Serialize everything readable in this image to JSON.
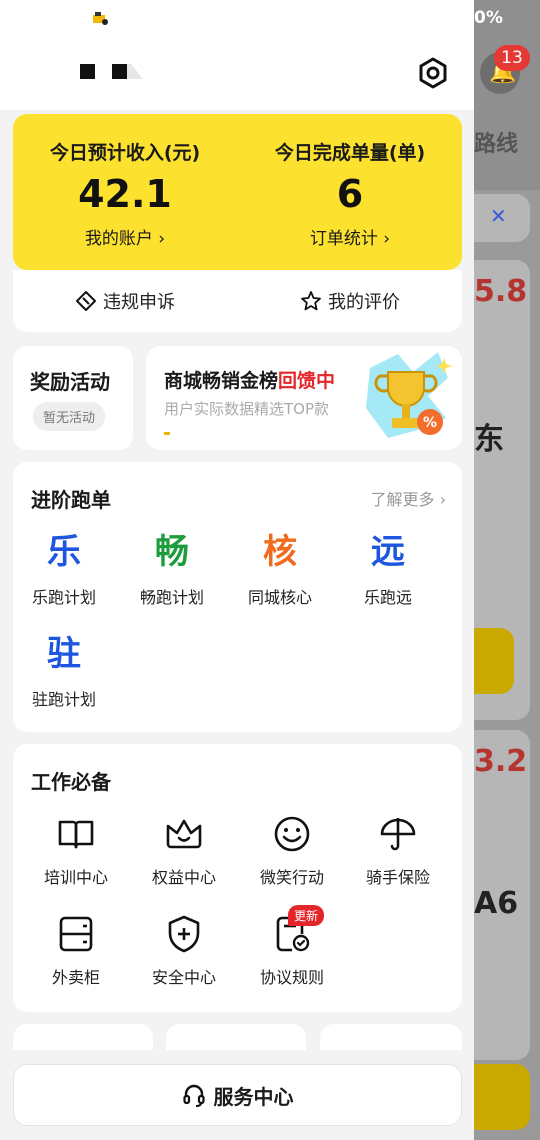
{
  "background": {
    "battery_text": "0%",
    "notification_count": "13",
    "route_text": "路线",
    "price_1": "5.8",
    "price_2": "3.2",
    "char_1": "东",
    "char_2": "A6"
  },
  "stats": {
    "income_label": "今日预计收入(元)",
    "income_value": "42.1",
    "account_link": "我的账户 ›",
    "orders_label": "今日完成单量(单)",
    "orders_value": "6",
    "orders_link": "订单统计 ›"
  },
  "actions": {
    "appeal": "违规申诉",
    "rating": "我的评价"
  },
  "rewards": {
    "title": "奖励活动",
    "tag": "暂无活动"
  },
  "banner": {
    "title_main": "商城畅销金榜",
    "title_highlight": "回馈中",
    "subtitle": "用户实际数据精选TOP款"
  },
  "advanced": {
    "title": "进阶跑单",
    "more": "了解更多 ›",
    "items": [
      {
        "glyph": "乐",
        "label": "乐跑计划",
        "color": "#1e56e0"
      },
      {
        "glyph": "畅",
        "label": "畅跑计划",
        "color": "#1e9b3c"
      },
      {
        "glyph": "核",
        "label": "同城核心",
        "color": "#f06b1e"
      },
      {
        "glyph": "远",
        "label": "乐跑远",
        "color": "#1e56e0"
      },
      {
        "glyph": "驻",
        "label": "驻跑计划",
        "color": "#1e56e0"
      }
    ]
  },
  "work": {
    "title": "工作必备",
    "items": [
      {
        "icon": "book-icon",
        "label": "培训中心"
      },
      {
        "icon": "crown-icon",
        "label": "权益中心"
      },
      {
        "icon": "smile-icon",
        "label": "微笑行动"
      },
      {
        "icon": "umbrella-icon",
        "label": "骑手保险"
      },
      {
        "icon": "locker-icon",
        "label": "外卖柜"
      },
      {
        "icon": "shield-icon",
        "label": "安全中心"
      },
      {
        "icon": "agreement-icon",
        "label": "协议规则"
      }
    ],
    "new_badge": "更新"
  },
  "service_center": "服务中心"
}
